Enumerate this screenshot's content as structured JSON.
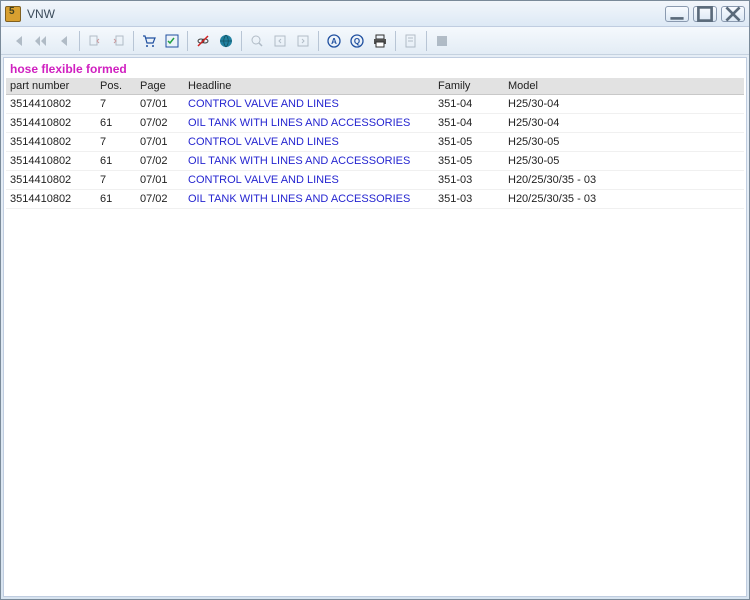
{
  "window": {
    "title": "VNW"
  },
  "search_title": "hose flexible formed",
  "columns": {
    "part_number": "part number",
    "pos": "Pos.",
    "page": "Page",
    "headline": "Headline",
    "family": "Family",
    "model": "Model"
  },
  "rows": [
    {
      "part_number": "3514410802",
      "pos": "7",
      "page": "07/01",
      "headline": "CONTROL VALVE AND LINES",
      "family": "351-04",
      "model": "H25/30-04"
    },
    {
      "part_number": "3514410802",
      "pos": "61",
      "page": "07/02",
      "headline": "OIL TANK WITH LINES AND ACCESSORIES",
      "family": "351-04",
      "model": "H25/30-04"
    },
    {
      "part_number": "3514410802",
      "pos": "7",
      "page": "07/01",
      "headline": "CONTROL VALVE AND LINES",
      "family": "351-05",
      "model": "H25/30-05"
    },
    {
      "part_number": "3514410802",
      "pos": "61",
      "page": "07/02",
      "headline": "OIL TANK WITH LINES AND ACCESSORIES",
      "family": "351-05",
      "model": "H25/30-05"
    },
    {
      "part_number": "3514410802",
      "pos": "7",
      "page": "07/01",
      "headline": "CONTROL VALVE AND LINES",
      "family": "351-03",
      "model": "H20/25/30/35 - 03"
    },
    {
      "part_number": "3514410802",
      "pos": "61",
      "page": "07/02",
      "headline": "OIL TANK WITH LINES AND ACCESSORIES",
      "family": "351-03",
      "model": "H20/25/30/35 - 03"
    }
  ]
}
